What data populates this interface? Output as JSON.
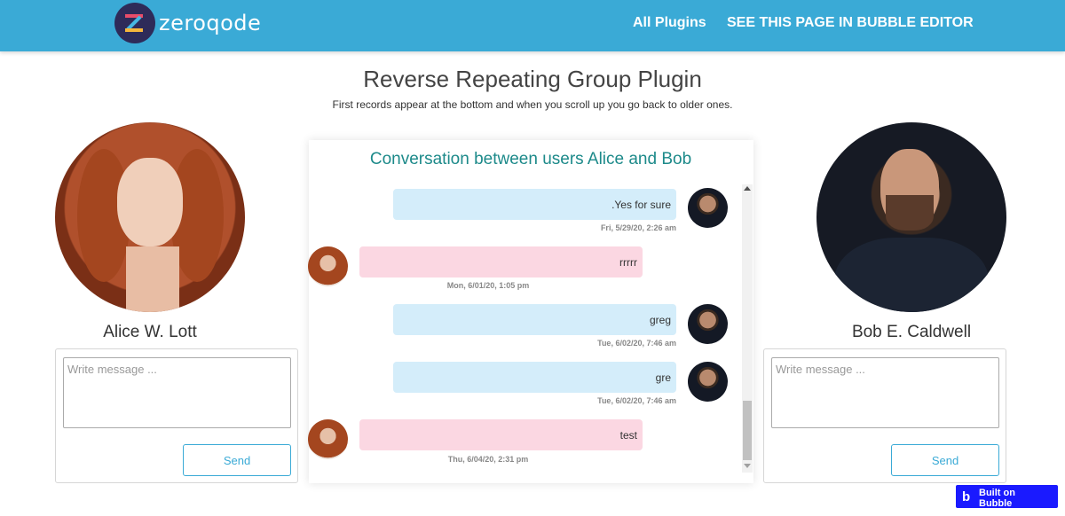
{
  "header": {
    "logo_text": "zeroqode",
    "nav_all_plugins": "All Plugins",
    "nav_bubble_editor": "SEE THIS PAGE IN BUBBLE EDITOR"
  },
  "page": {
    "title": "Reverse Repeating Group Plugin",
    "subtitle": "First records appear at the bottom and when you scroll up you go back to older ones."
  },
  "users": {
    "alice": {
      "name": "Alice W. Lott",
      "placeholder": "Write message ...",
      "send_label": "Send"
    },
    "bob": {
      "name": "Bob E. Caldwell",
      "placeholder": "Write message ...",
      "send_label": "Send"
    }
  },
  "conversation": {
    "title": "Conversation between users Alice and Bob",
    "messages": [
      {
        "sender": "bob",
        "text": ".Yes for sure",
        "timestamp": "Fri, 5/29/20, 2:26 am"
      },
      {
        "sender": "alice",
        "text": "rrrrr",
        "timestamp": "Mon, 6/01/20, 1:05 pm"
      },
      {
        "sender": "bob",
        "text": "greg",
        "timestamp": "Tue, 6/02/20, 7:46 am"
      },
      {
        "sender": "bob",
        "text": "gre",
        "timestamp": "Tue, 6/02/20, 7:46 am"
      },
      {
        "sender": "alice",
        "text": "test",
        "timestamp": "Thu, 6/04/20, 2:31 pm"
      }
    ]
  },
  "badge": {
    "icon": "b",
    "text": "Built on Bubble"
  },
  "colors": {
    "header": "#3aaad6",
    "conversation_title": "#1d8a8a",
    "bob_bubble": "#d4edfa",
    "alice_bubble": "#fbd7e2",
    "badge": "#1a1aff"
  }
}
